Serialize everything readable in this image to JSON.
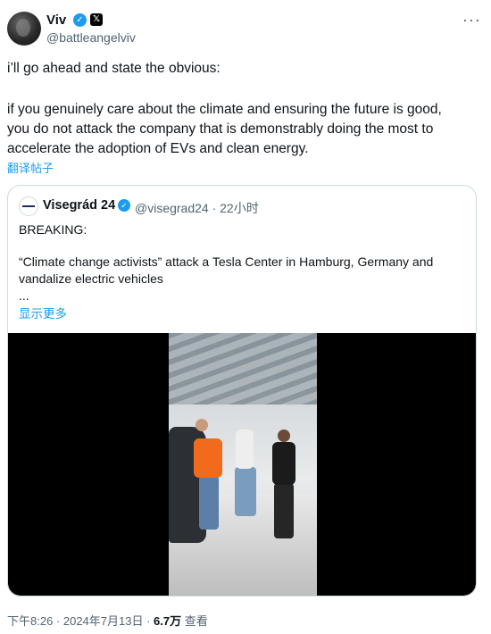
{
  "author": {
    "name": "Viv",
    "handle": "@battleangelviv"
  },
  "tweet": {
    "line1": "i’ll go ahead and state the obvious:",
    "line2": "if you genuinely care about the climate and ensuring the future is good,",
    "line3": "you do not attack the company that is demonstrably doing the most to",
    "line4": "accelerate the adoption of EVs and clean energy.",
    "translate_label": "翻译帖子"
  },
  "quote": {
    "name": "Visegrád 24",
    "meta": "@visegrad24 · 22小时",
    "line1": "BREAKING:",
    "line2": "“Climate change activists” attack a Tesla Center in Hamburg, Germany and",
    "line3": "vandalize electric vehicles",
    "ellipsis": "...",
    "show_more": "显示更多"
  },
  "footer": {
    "time_date": "下午8:26 · 2024年7月13日 · ",
    "views_count": "6.7万",
    "views_label": " 查看"
  },
  "colors": {
    "accent": "#1d9bf0",
    "text": "#0f1419",
    "secondary": "#536471"
  }
}
